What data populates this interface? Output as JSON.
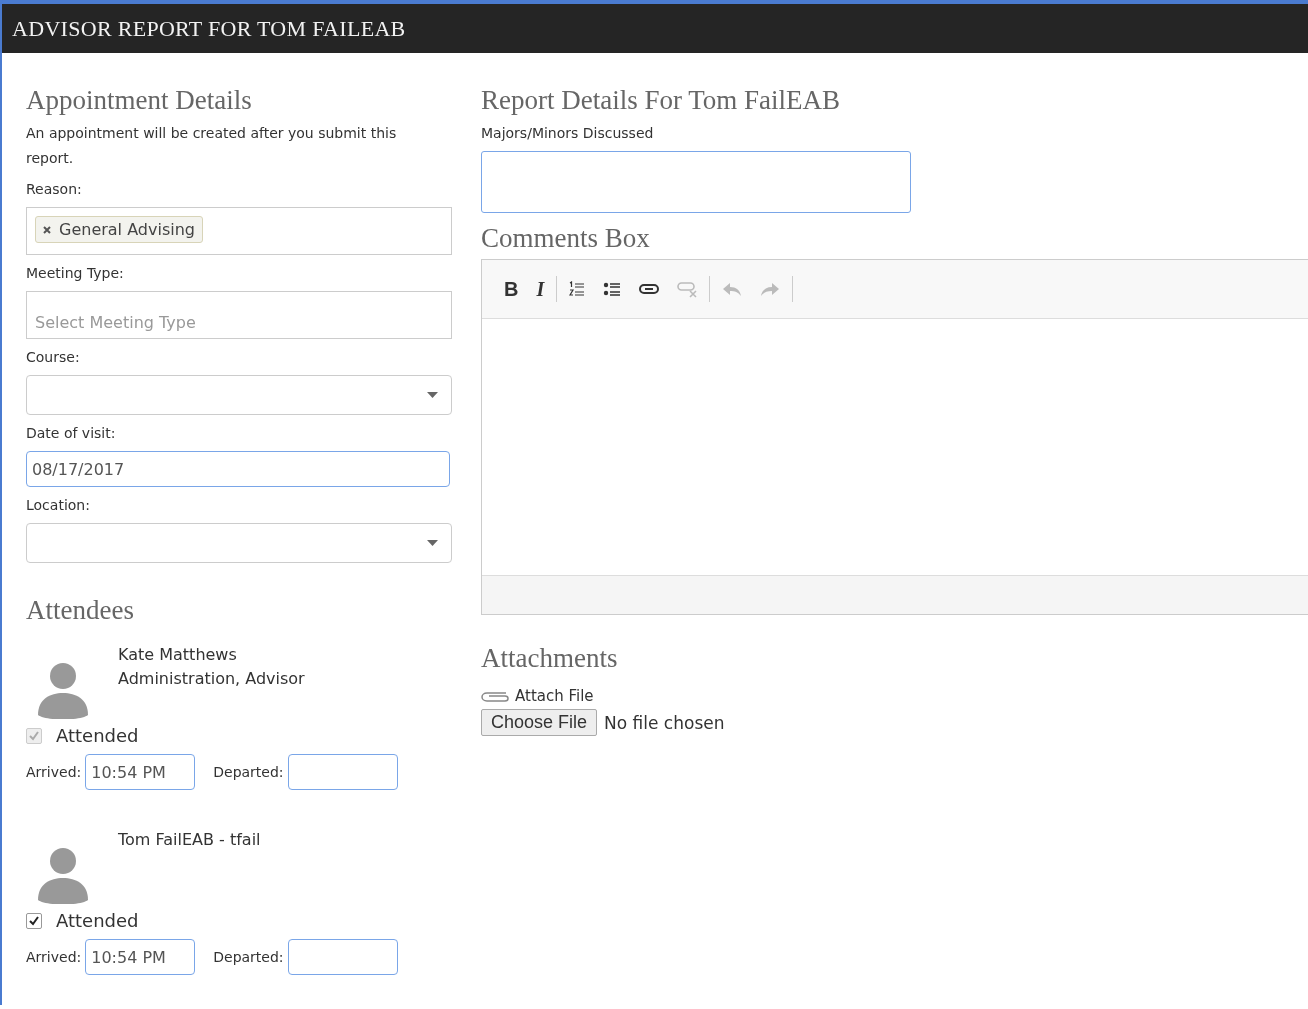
{
  "header": {
    "title": "ADVISOR REPORT FOR TOM FAILEAB"
  },
  "appointment": {
    "heading": "Appointment Details",
    "note": "An appointment will be created after you submit this report.",
    "reason": {
      "label": "Reason:",
      "tags": [
        "General Advising"
      ]
    },
    "meeting_type": {
      "label": "Meeting Type:",
      "placeholder": "Select Meeting Type"
    },
    "course": {
      "label": "Course:"
    },
    "date": {
      "label": "Date of visit:",
      "value": "08/17/2017"
    },
    "location": {
      "label": "Location:"
    }
  },
  "attendees": {
    "heading": "Attendees",
    "people": [
      {
        "lines": [
          "Kate Matthews",
          "Administration, Advisor"
        ],
        "attended": {
          "label": "Attended",
          "checked": true,
          "disabled": true
        },
        "arrived_label": "Arrived:",
        "arrived": "10:54 PM",
        "departed_label": "Departed:"
      },
      {
        "lines": [
          "Tom FailEAB - tfail"
        ],
        "attended": {
          "label": "Attended",
          "checked": true,
          "disabled": false
        },
        "arrived_label": "Arrived:",
        "arrived": "10:54 PM",
        "departed_label": "Departed:"
      }
    ]
  },
  "report": {
    "heading": "Report Details For Tom FailEAB",
    "majors_label": "Majors/Minors Discussed"
  },
  "comments": {
    "heading": "Comments Box",
    "toolbar": [
      {
        "kind": "bold",
        "label": "B",
        "disabled": false
      },
      {
        "kind": "italic",
        "label": "I",
        "disabled": false
      },
      {
        "kind": "separator"
      },
      {
        "kind": "numbered-list",
        "disabled": false
      },
      {
        "kind": "bulleted-list",
        "disabled": false
      },
      {
        "kind": "link",
        "disabled": false
      },
      {
        "kind": "unlink",
        "disabled": true
      },
      {
        "kind": "separator"
      },
      {
        "kind": "undo",
        "disabled": true
      },
      {
        "kind": "redo",
        "disabled": true
      },
      {
        "kind": "separator"
      }
    ]
  },
  "attachments": {
    "heading": "Attachments",
    "attach_label": "Attach File",
    "button": "Choose File",
    "status": "No file chosen"
  }
}
